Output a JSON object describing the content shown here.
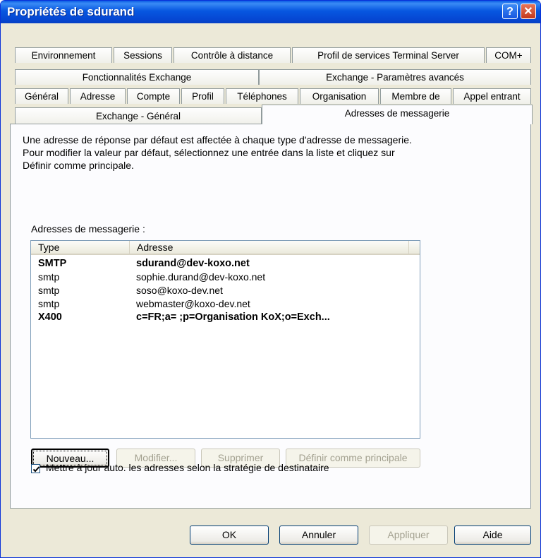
{
  "window": {
    "title": "Propriétés de sdurand",
    "help_label": "?",
    "close_label": "✕"
  },
  "tabs": {
    "row1": [
      "Environnement",
      "Sessions",
      "Contrôle à distance",
      "Profil de services Terminal Server",
      "COM+"
    ],
    "row2": [
      "Fonctionnalités Exchange",
      "Exchange - Paramètres avancés"
    ],
    "row3": [
      "Général",
      "Adresse",
      "Compte",
      "Profil",
      "Téléphones",
      "Organisation",
      "Membre de",
      "Appel entrant"
    ],
    "row4": [
      "Exchange - Général",
      "Adresses de messagerie"
    ],
    "active": "Adresses de messagerie"
  },
  "description": "Une adresse de réponse par défaut est affectée à chaque type d'adresse de messagerie. Pour modifier la valeur par défaut, sélectionnez une entrée dans la liste et cliquez sur Définir comme principale.",
  "list": {
    "label": "Adresses de messagerie :",
    "columns": [
      "Type",
      "Adresse"
    ],
    "rows": [
      {
        "type": "SMTP",
        "address": "sdurand@dev-koxo.net",
        "primary": true
      },
      {
        "type": "smtp",
        "address": "sophie.durand@dev-koxo.net",
        "primary": false
      },
      {
        "type": "smtp",
        "address": "soso@koxo-dev.net",
        "primary": false
      },
      {
        "type": "smtp",
        "address": "webmaster@koxo-dev.net",
        "primary": false
      },
      {
        "type": "X400",
        "address": "c=FR;a= ;p=Organisation KoX;o=Exch...",
        "primary": true
      }
    ]
  },
  "list_buttons": {
    "new": "Nouveau...",
    "modify": "Modifier...",
    "delete": "Supprimer",
    "set_primary": "Définir comme principale"
  },
  "checkbox": {
    "label": "Mettre à jour auto. les adresses selon la stratégie de destinataire",
    "checked": true
  },
  "dialog_buttons": {
    "ok": "OK",
    "cancel": "Annuler",
    "apply": "Appliquer",
    "help": "Aide"
  }
}
